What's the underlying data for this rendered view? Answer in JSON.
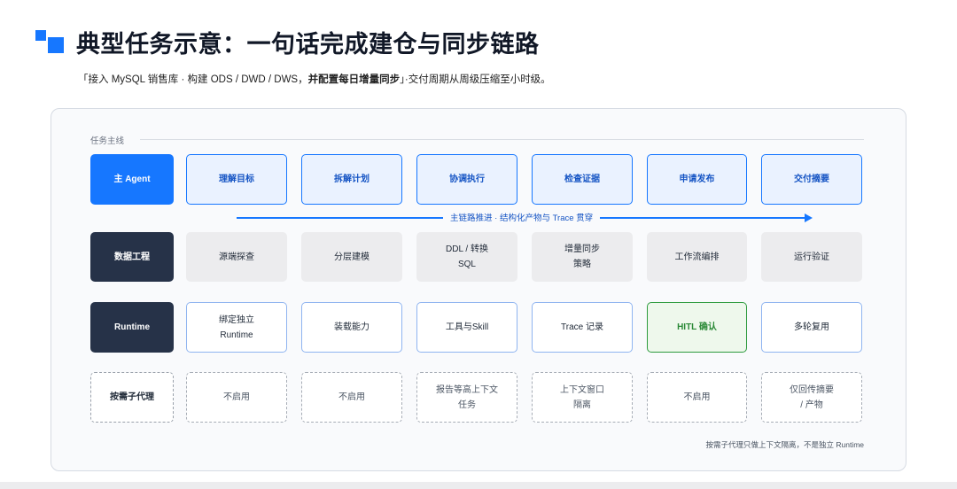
{
  "header": {
    "title": "典型任务示意：一句话完成建仓与同步链路",
    "subtitle_quote_open": "「接入 MySQL 销售库 · 构建 ODS / DWD / DWS，",
    "subtitle_bold": "并配置每日增量同步",
    "subtitle_rest": "」·交付周期从周级压缩至小时级。"
  },
  "lane": {
    "label": "任务主线"
  },
  "row1": {
    "head": "主 Agent",
    "steps": [
      "理解目标",
      "拆解计划",
      "协调执行",
      "检查证据",
      "申请发布",
      "交付摘要"
    ]
  },
  "arrow": {
    "label": "主链路推进 · 结构化产物与 Trace 贯穿"
  },
  "row2": {
    "head": "数据工程",
    "cells": [
      [
        "源端探查"
      ],
      [
        "分层建模"
      ],
      [
        "DDL / 转换",
        "SQL"
      ],
      [
        "增量同步",
        "策略"
      ],
      [
        "工作流编排"
      ],
      [
        "运行验证"
      ]
    ]
  },
  "row3": {
    "head": "Runtime",
    "cells": [
      [
        "绑定独立",
        "Runtime"
      ],
      [
        "装载能力"
      ],
      [
        "工具与Skill"
      ],
      [
        "Trace 记录"
      ],
      [
        "HITL 确认"
      ],
      [
        "多轮复用"
      ]
    ]
  },
  "row4": {
    "head": "按需子代理",
    "cells": [
      [
        "不启用"
      ],
      [
        "不启用"
      ],
      [
        "报告等高上下文",
        "任务"
      ],
      [
        "上下文窗口",
        "隔离"
      ],
      [
        "不启用"
      ],
      [
        "仅回传摘要",
        "/ 产物"
      ]
    ]
  },
  "footnote": "按需子代理只做上下文隔离，不是独立 Runtime",
  "colors": {
    "accent": "#1677ff",
    "dark": "#263248",
    "hitl": "#2e9b3e"
  }
}
